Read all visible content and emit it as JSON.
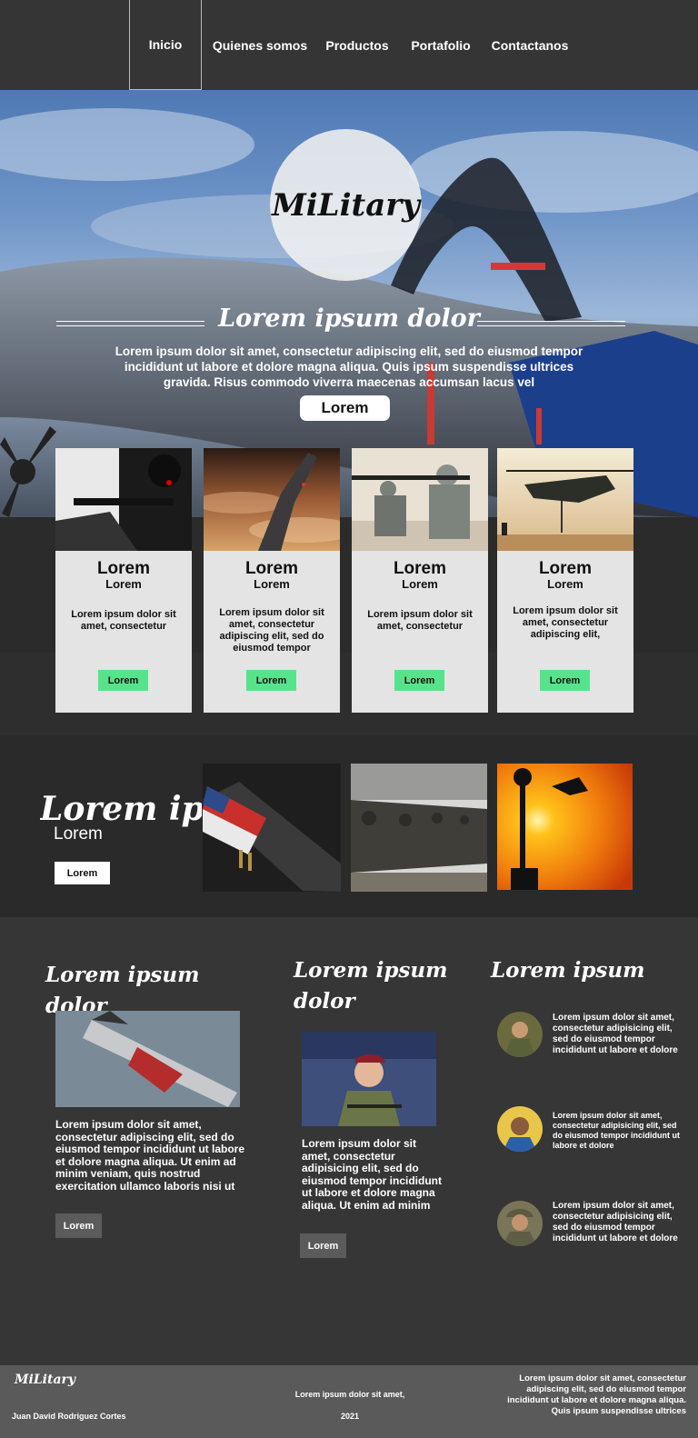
{
  "nav": {
    "items": [
      {
        "label": "Inicio"
      },
      {
        "label": "Quienes somos"
      },
      {
        "label": "Productos"
      },
      {
        "label": "Portafolio"
      },
      {
        "label": "Contactanos"
      }
    ]
  },
  "hero": {
    "logo": "MiLitary",
    "title": "Lorem ipsum dolor",
    "text": "Lorem ipsum dolor sit amet, consectetur adipiscing elit, sed do eiusmod tempor incididunt ut labore et dolore magna aliqua. Quis ipsum suspendisse ultrices gravida. Risus commodo viverra maecenas accumsan lacus vel",
    "button": "Lorem"
  },
  "cards": [
    {
      "title": "Lorem",
      "subtitle": "Lorem",
      "text": "Lorem ipsum dolor sit amet, consectetur",
      "button": "Lorem"
    },
    {
      "title": "Lorem",
      "subtitle": "Lorem",
      "text": "Lorem ipsum dolor sit amet, consectetur adipiscing elit, sed do eiusmod tempor",
      "button": "Lorem"
    },
    {
      "title": "Lorem",
      "subtitle": "Lorem",
      "text": "Lorem ipsum dolor sit amet, consectetur",
      "button": "Lorem"
    },
    {
      "title": "Lorem",
      "subtitle": "Lorem",
      "text": "Lorem ipsum dolor sit amet, consectetur adipiscing elit,",
      "button": "Lorem"
    }
  ],
  "strip": {
    "title": "Lorem ipsum",
    "subtitle": "Lorem",
    "button": "Lorem"
  },
  "blog": {
    "col1": {
      "title": "Lorem ipsum dolor",
      "text": "Lorem ipsum dolor sit amet, consectetur adipiscing elit, sed do eiusmod tempor incididunt ut labore et dolore magna aliqua. Ut enim ad minim veniam, quis nostrud exercitation ullamco laboris nisi ut",
      "button": "Lorem"
    },
    "col2": {
      "title": "Lorem ipsum dolor",
      "text": "Lorem ipsum dolor sit amet, consectetur adipisicing elit, sed do eiusmod tempor incididunt ut labore et dolore magna aliqua. Ut enim ad minim",
      "button": "Lorem"
    },
    "col3": {
      "title": "Lorem ipsum",
      "testimonials": [
        {
          "text": "Lorem ipsum dolor sit amet, consectetur adipisicing elit, sed do eiusmod tempor incididunt ut labore et dolore"
        },
        {
          "text": "Lorem ipsum dolor sit amet, consectetur adipisicing elit, sed do eiusmod tempor incididunt ut labore et dolore"
        },
        {
          "text": "Lorem ipsum dolor sit amet, consectetur adipisicing elit, sed do eiusmod tempor incididunt ut labore et dolore"
        }
      ]
    }
  },
  "footer": {
    "logo": "MiLitary",
    "author": "Juan David Rodriguez Cortes",
    "center_text": "Lorem ipsum dolor sit amet,",
    "year": "2021",
    "right_text": "Lorem ipsum dolor sit amet, consectetur adipiscing elit, sed do eiusmod tempor incididunt ut labore et dolore magna aliqua. Quis ipsum suspendisse ultrices"
  }
}
